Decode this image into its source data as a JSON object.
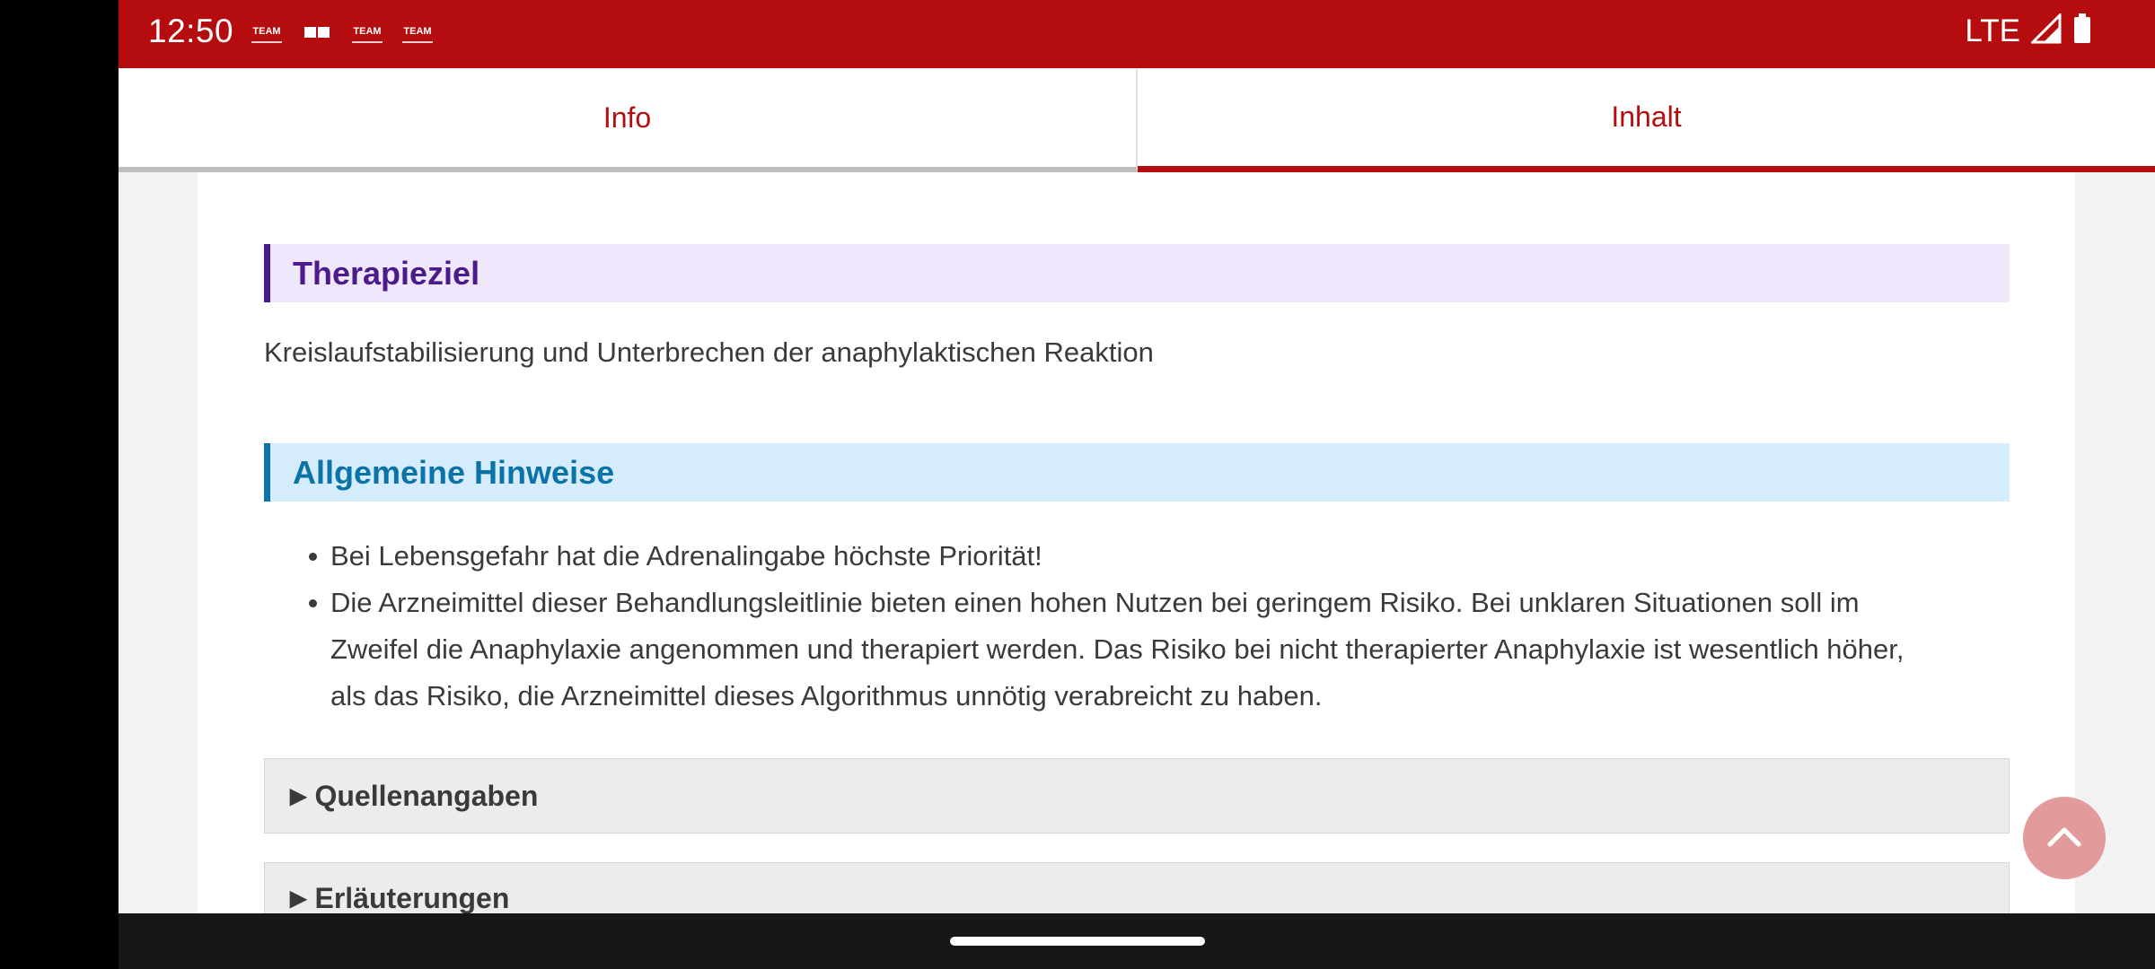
{
  "status_bar": {
    "time": "12:50",
    "notifications": [
      "team-icon",
      "book-icon",
      "team-icon",
      "team-icon"
    ],
    "notif_label": "TEAM",
    "network": "LTE",
    "signal_icon": "signal-icon",
    "battery_icon": "battery-icon"
  },
  "tabs": [
    {
      "label": "Info",
      "active": false
    },
    {
      "label": "Inhalt",
      "active": true
    }
  ],
  "sections": {
    "therapieziel": {
      "title": "Therapieziel",
      "text": "Kreislaufstabilisierung und Unterbrechen der anaphylaktischen Reaktion"
    },
    "hinweise": {
      "title": "Allgemeine Hinweise",
      "items": [
        "Bei Lebensgefahr hat die Adrenalingabe höchste Priorität!",
        "Die Arzneimittel dieser Behandlungsleitlinie bieten einen hohen Nutzen bei geringem Risiko. Bei unklaren Situationen soll im Zweifel die Anaphylaxie angenommen und therapiert werden. Das Risiko bei nicht therapierter Anaphylaxie ist wesentlich höher, als das Risiko, die Arzneimittel dieses Algorithmus unnötig verabreicht zu haben."
      ]
    },
    "collapsibles": [
      {
        "label": "Quellenangaben",
        "expanded": false
      },
      {
        "label": "Erläuterungen",
        "expanded": false
      }
    ]
  },
  "colors": {
    "brand_red": "#b50d0f",
    "purple": "#4b1b8c",
    "blue": "#0b73a8"
  }
}
